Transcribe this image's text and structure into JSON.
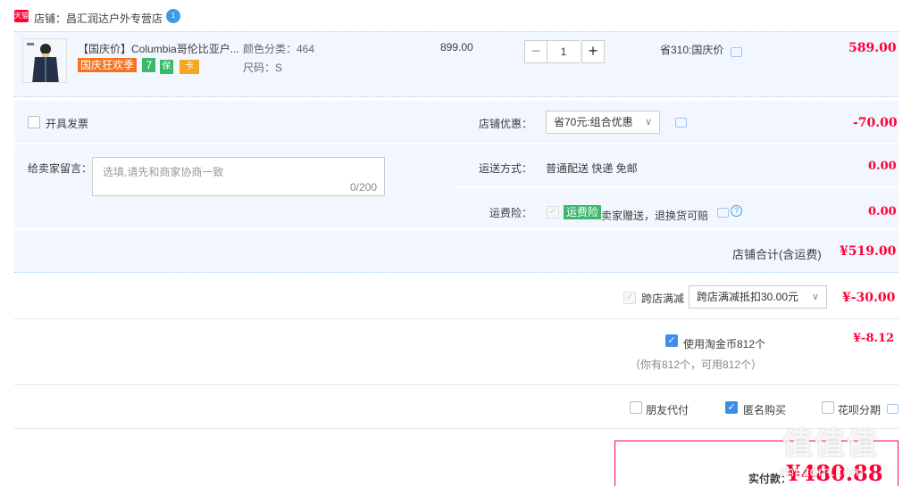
{
  "shop": {
    "platform_badge": "天猫",
    "label": "店铺：昌汇润达户外专营店",
    "badge_count": "1"
  },
  "item": {
    "title": "【国庆价】Columbia哥伦比亚户...",
    "tags": [
      "国庆狂欢季",
      "7",
      "保",
      "卡"
    ],
    "sku_color": "颜色分类：464",
    "sku_size": "尺码：S",
    "unit_price": "899.00",
    "quantity": "1",
    "discount_note": "省310:国庆价",
    "total": "589.00"
  },
  "invoice": {
    "label": "开具发票"
  },
  "message": {
    "label": "给卖家留言：",
    "placeholder": "选填,请先和商家协商一致",
    "counter": "0/200"
  },
  "store_discount": {
    "label": "店铺优惠：",
    "selected": "省70元:组合优惠",
    "amount": "-70.00"
  },
  "shipping": {
    "label": "运送方式：",
    "value": "普通配送 快递 免邮",
    "amount": "0.00"
  },
  "insurance": {
    "label": "运费险：",
    "tag": "运费险",
    "text": "卖家赠送，退换货可赔",
    "amount": "0.00"
  },
  "subtotal": {
    "label": "店铺合计(含运费)",
    "amount": "¥519.00"
  },
  "cross_store": {
    "label": "跨店满减",
    "selected": "跨店满减抵扣30.00元",
    "amount": "¥-30.00"
  },
  "taojinbi": {
    "label": "使用淘金币812个",
    "note": "（你有812个，可用812个）",
    "amount": "¥-8.12"
  },
  "options": {
    "friend_pay": "朋友代付",
    "anonymous": "匿名购买",
    "huabei": "花呗分期"
  },
  "payment": {
    "label": "实付款：",
    "amount": "¥480.88"
  },
  "watermark": {
    "logo": "值值值",
    "url": "zhi.zdm.com"
  },
  "colors": {
    "accent": "#ff0036",
    "panel": "#f2f7ff",
    "checkbox": "#3d8ee8"
  }
}
